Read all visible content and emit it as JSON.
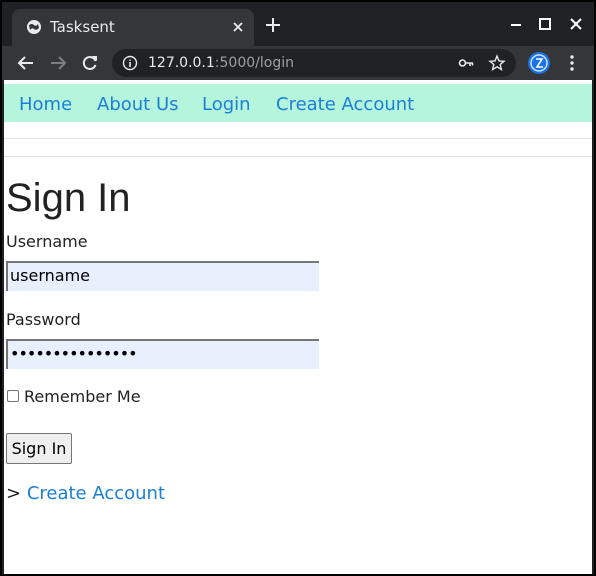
{
  "browser": {
    "tab_title": "Tasksent",
    "url_host": "127.0.0.1",
    "url_path": ":5000/login",
    "icons": [
      "globe-icon",
      "close-icon",
      "plus-icon",
      "minimize-icon",
      "maximize-icon",
      "window-close-icon",
      "back-icon",
      "forward-icon",
      "reload-icon",
      "info-icon",
      "key-icon",
      "star-icon",
      "profile-avatar",
      "more-menu-icon"
    ],
    "colors": {
      "frame": "#202124",
      "toolbar": "#35363a"
    }
  },
  "nav": {
    "items": [
      {
        "label": "Home"
      },
      {
        "label": "About Us"
      },
      {
        "label": "Login"
      },
      {
        "label": "Create Account"
      }
    ],
    "colors": {
      "background": "#b5f5dc",
      "link": "#1a7fd6"
    }
  },
  "form": {
    "title": "Sign In",
    "username_label": "Username",
    "username_value": "username",
    "password_label": "Password",
    "password_value": "•••••••••••••••",
    "remember_label": "Remember Me",
    "remember_checked": false,
    "submit_label": "Sign In",
    "create_prefix": "> ",
    "create_link": "Create Account",
    "colors": {
      "input_autofill": "#e8f0fe"
    }
  }
}
